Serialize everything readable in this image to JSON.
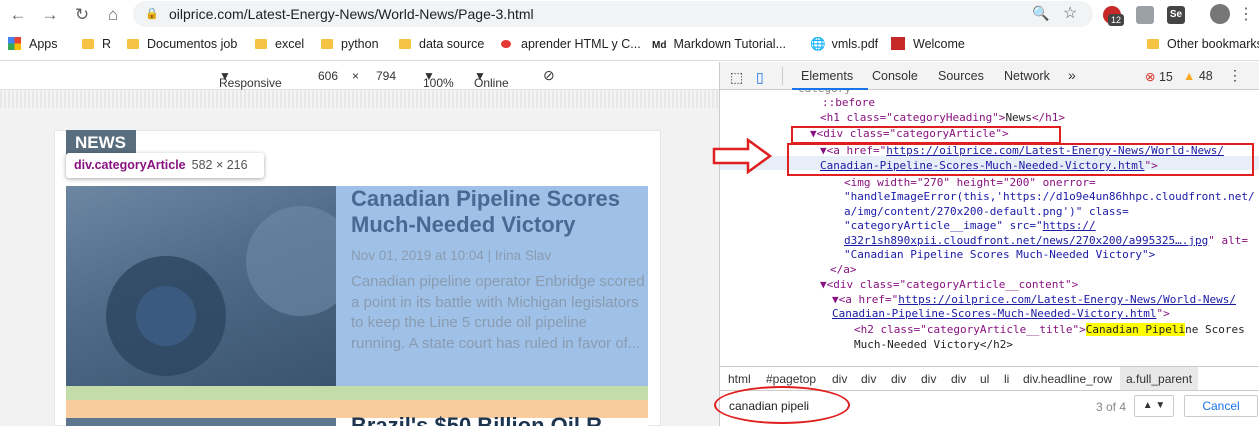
{
  "browser": {
    "url": "oilprice.com/Latest-Energy-News/World-News/Page-3.html",
    "ext_badge_1": "12",
    "ext_badge_2": "Se"
  },
  "bookmarks": {
    "items": [
      "Apps",
      "R",
      "Documentos job",
      "excel",
      "python",
      "data source",
      "aprender HTML y C...",
      "Markdown Tutorial...",
      "vmls.pdf",
      "Welcome"
    ],
    "other": "Other bookmarks"
  },
  "responsive_toolbar": {
    "mode": "Responsive",
    "width": "606",
    "times": "×",
    "height": "794",
    "zoom": "100%",
    "network": "Online"
  },
  "page": {
    "section_tag": "NEWS",
    "tooltip_selector": "div.categoryArticle",
    "tooltip_size": "582 × 216",
    "headline": "Canadian Pipeline Scores Much-Needed Victory",
    "meta": "Nov 01, 2019 at 10:04 | Irina Slav",
    "excerpt": "Canadian pipeline operator Enbridge scored a point in its battle with Michigan legislators to keep the Line 5 crude oil pipeline running. A state court has ruled in favor of...",
    "next_headline": "Brazil's $50 Billion Oil R"
  },
  "devtools": {
    "tabs": [
      "Elements",
      "Console",
      "Sources",
      "Network"
    ],
    "more": "»",
    "errors": "15",
    "warnings": "48",
    "dom": {
      "line0": "category",
      "before": "::before",
      "h1_open": "<h1 class=\"categoryHeading\">",
      "h1_text": "News",
      "h1_close": "</h1>",
      "div_article": "<div class=\"categoryArticle\">",
      "a_open": "<a href=\"",
      "a_href_1": "https://oilprice.com/Latest-Energy-News/World-News/",
      "a_href_2": "Canadian-Pipeline-Scores-Much-Needed-Victory.html",
      "a_close_q": "\">",
      "img_1": "<img width=\"270\" height=\"200\" onerror=",
      "img_2": "\"handleImageError(this,'https://d1o9e4un86hhpc.cloudfront.net/",
      "img_3": "a/img/content/270x200-default.png')\" class=",
      "img_4": "\"categoryArticle__image\" src=\"",
      "img_src_1": "https://",
      "img_src_2": "d32r1sh890xpii.cloudfront.net/news/270x200/a995325….jpg",
      "img_5": "\" alt=",
      "img_6": "\"Canadian Pipeline Scores Much-Needed Victory\">",
      "a_end": "</a>",
      "div_content": "<div class=\"categoryArticle__content\">",
      "a2_open": "<a href=\"",
      "a2_href_1": "https://oilprice.com/Latest-Energy-News/World-News/",
      "a2_href_2": "Canadian-Pipeline-Scores-Much-Needed-Victory.html",
      "a2_close_q": "\">",
      "h2_open": "<h2 class=\"categoryArticle__title\">",
      "h2_hl": "Canadian Pipeli",
      "h2_rest": "ne Scores",
      "h2_line2": "Much-Needed Victory</h2>"
    },
    "breadcrumbs": [
      "html",
      "#pagetop",
      "div",
      "div",
      "div",
      "div",
      "div",
      "ul",
      "li",
      "div.headline_row",
      "a.full_parent"
    ],
    "find": {
      "query": "canadian pipeli",
      "count": "3 of 4",
      "cancel": "Cancel"
    }
  },
  "colors": {
    "annotation": "#e02020",
    "article_highlight": "#9fc1e7",
    "padding": "#c3dca9",
    "margin": "#f9cc9d"
  }
}
